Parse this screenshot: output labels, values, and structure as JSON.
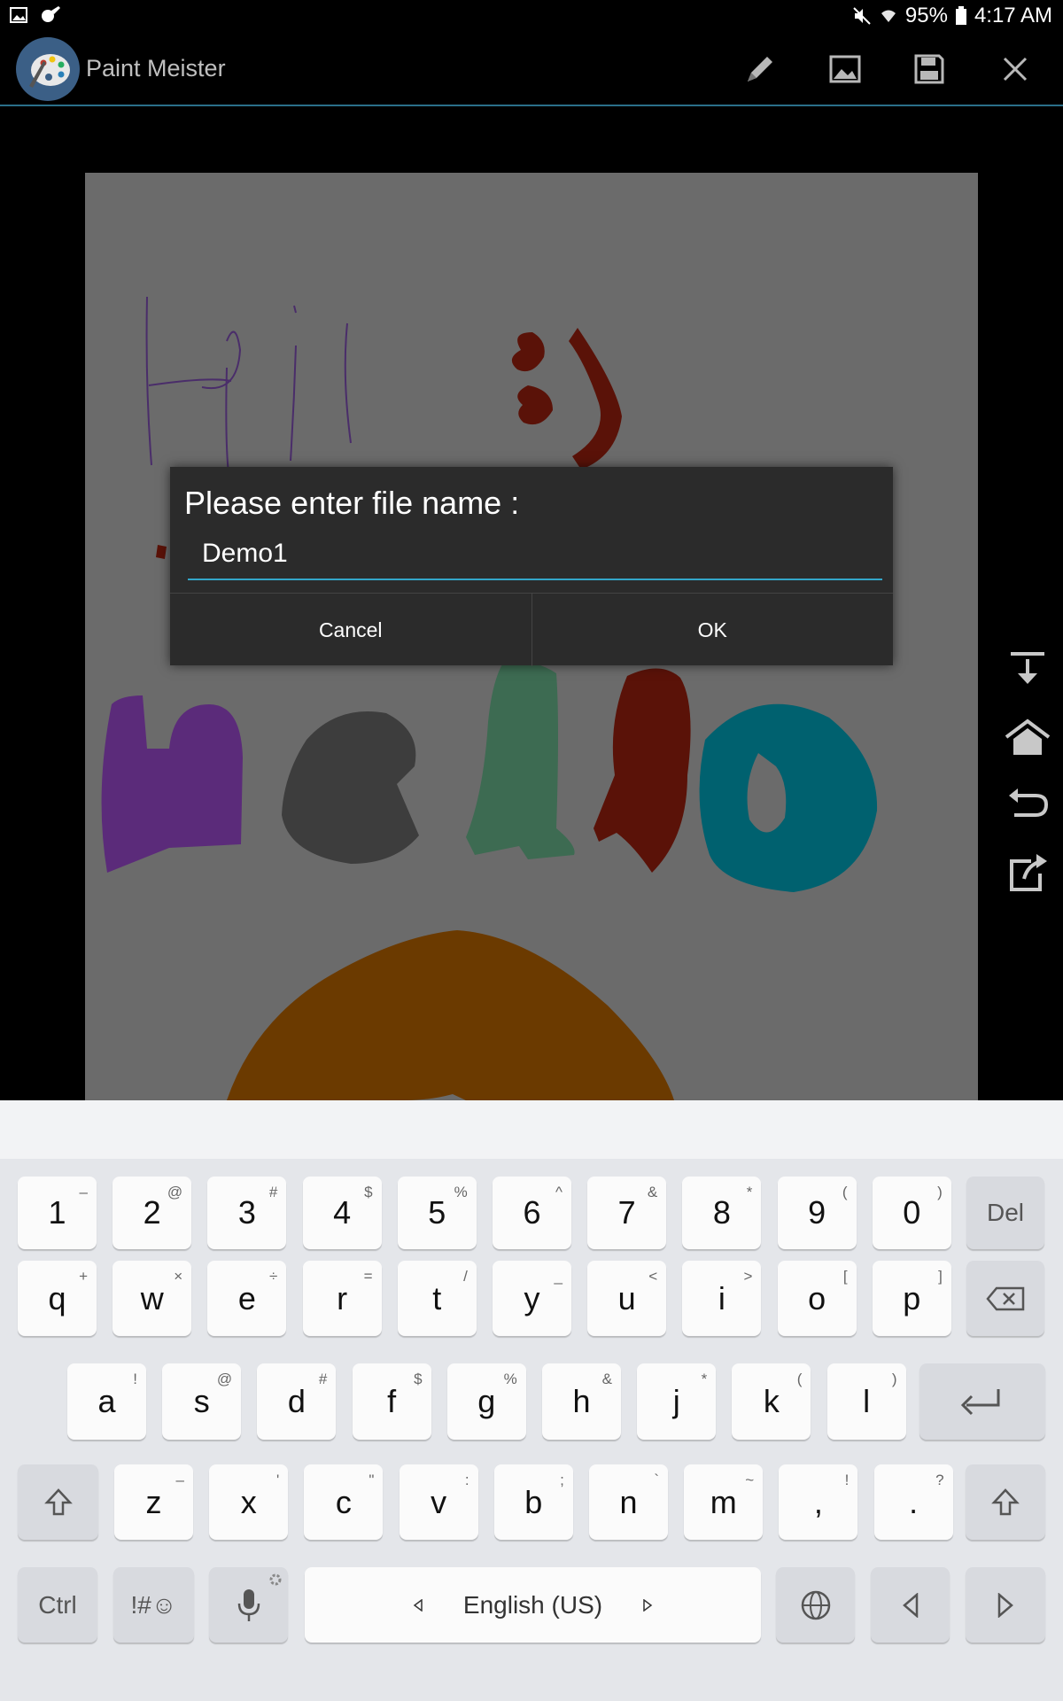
{
  "status": {
    "battery": "95%",
    "time": "4:17 AM"
  },
  "app": {
    "title": "Paint Meister"
  },
  "dialog": {
    "title": "Please enter file name :",
    "value": "Demo1",
    "cancel": "Cancel",
    "ok": "OK"
  },
  "drawing": {
    "text": "Hi!"
  },
  "keyboard": {
    "numbers": [
      {
        "k": "1",
        "s": "–"
      },
      {
        "k": "2",
        "s": "@"
      },
      {
        "k": "3",
        "s": "#"
      },
      {
        "k": "4",
        "s": "$"
      },
      {
        "k": "5",
        "s": "%"
      },
      {
        "k": "6",
        "s": "^"
      },
      {
        "k": "7",
        "s": "&"
      },
      {
        "k": "8",
        "s": "*"
      },
      {
        "k": "9",
        "s": "("
      },
      {
        "k": "0",
        "s": ")"
      }
    ],
    "del": "Del",
    "row_q": [
      {
        "k": "q",
        "s": "+"
      },
      {
        "k": "w",
        "s": "×"
      },
      {
        "k": "e",
        "s": "÷"
      },
      {
        "k": "r",
        "s": "="
      },
      {
        "k": "t",
        "s": "/"
      },
      {
        "k": "y",
        "s": "_"
      },
      {
        "k": "u",
        "s": "<"
      },
      {
        "k": "i",
        "s": ">"
      },
      {
        "k": "o",
        "s": "["
      },
      {
        "k": "p",
        "s": "]"
      }
    ],
    "row_a": [
      {
        "k": "a",
        "s": "!"
      },
      {
        "k": "s",
        "s": "@"
      },
      {
        "k": "d",
        "s": "#"
      },
      {
        "k": "f",
        "s": "$"
      },
      {
        "k": "g",
        "s": "%"
      },
      {
        "k": "h",
        "s": "&"
      },
      {
        "k": "j",
        "s": "*"
      },
      {
        "k": "k",
        "s": "("
      },
      {
        "k": "l",
        "s": ")"
      }
    ],
    "row_z": [
      {
        "k": "z",
        "s": "–"
      },
      {
        "k": "x",
        "s": "'"
      },
      {
        "k": "c",
        "s": "\""
      },
      {
        "k": "v",
        "s": ":"
      },
      {
        "k": "b",
        "s": ";"
      },
      {
        "k": "n",
        "s": "`"
      },
      {
        "k": "m",
        "s": "~"
      },
      {
        "k": ",",
        "s": "!"
      },
      {
        "k": ".",
        "s": "?"
      }
    ],
    "ctrl": "Ctrl",
    "symbols": "!#☺",
    "space": "English (US)"
  },
  "colors": {
    "purple": "#5b2b7a",
    "gray_blob": "#3d3d3d",
    "green": "#3d6b52",
    "maroon": "#5a1208",
    "teal": "#00616f",
    "orange": "#6b3a00",
    "accent": "#33a6c9"
  }
}
